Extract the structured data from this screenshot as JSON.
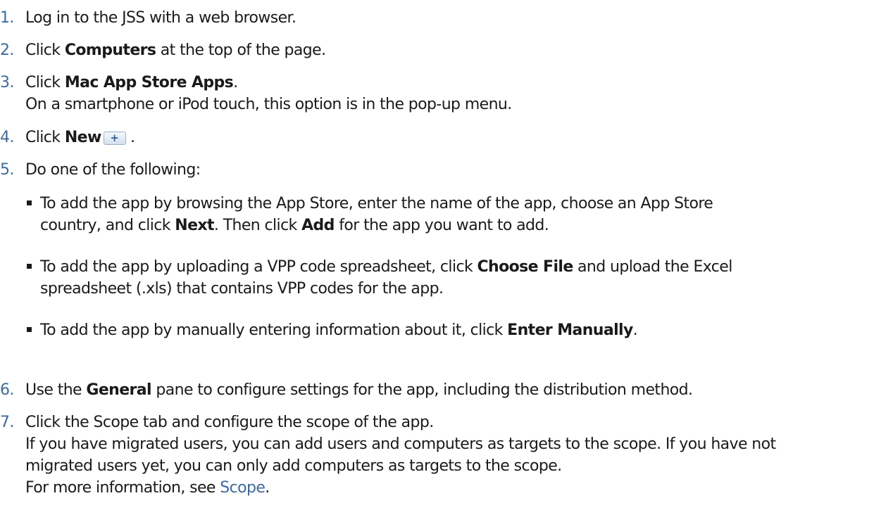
{
  "steps": [
    {
      "num": "1.",
      "text": "Log in to the JSS with a web browser."
    },
    {
      "num": "2.",
      "pre": "Click ",
      "bold": "Computers",
      "post": " at the top of the page."
    },
    {
      "num": "3.",
      "pre": "Click ",
      "bold": "Mac App Store Apps",
      "post": ".",
      "line2": "On a smartphone or iPod touch, this option is in the pop-up menu."
    },
    {
      "num": "4.",
      "pre": "Click ",
      "bold": "New",
      "button": "+",
      "post": " ."
    },
    {
      "num": "5.",
      "text": "Do one of the following:"
    },
    {
      "num": "6.",
      "pre": "Use the ",
      "bold": "General",
      "post": " pane to configure settings for the app, including the distribution method."
    },
    {
      "num": "7.",
      "text": "Click the Scope tab and configure the scope of the app.",
      "line2": "If you have migrated users, you can add users and computers as targets to the scope. If you have not",
      "line3": "migrated users yet, you can only add computers as targets to the scope.",
      "line4_pre": "For more information, see ",
      "link": "Scope",
      "line4_post": "."
    }
  ],
  "bullets": [
    {
      "l1_pre": "To add the app by browsing the App Store, enter the name of the app, choose an App Store",
      "l2_pre": "country, and click ",
      "b1": "Next",
      "l2_mid": ". Then click ",
      "b2": "Add",
      "l2_post": " for the app you want to add."
    },
    {
      "l1_pre": "To add the app by uploading a VPP code spreadsheet, click ",
      "b1": "Choose File",
      "l1_post": " and upload the Excel",
      "l2": "spreadsheet (.xls) that contains VPP codes for the app."
    },
    {
      "pre": "To add the app by manually entering information about it, click ",
      "b1": "Enter Manually",
      "post": "."
    }
  ]
}
